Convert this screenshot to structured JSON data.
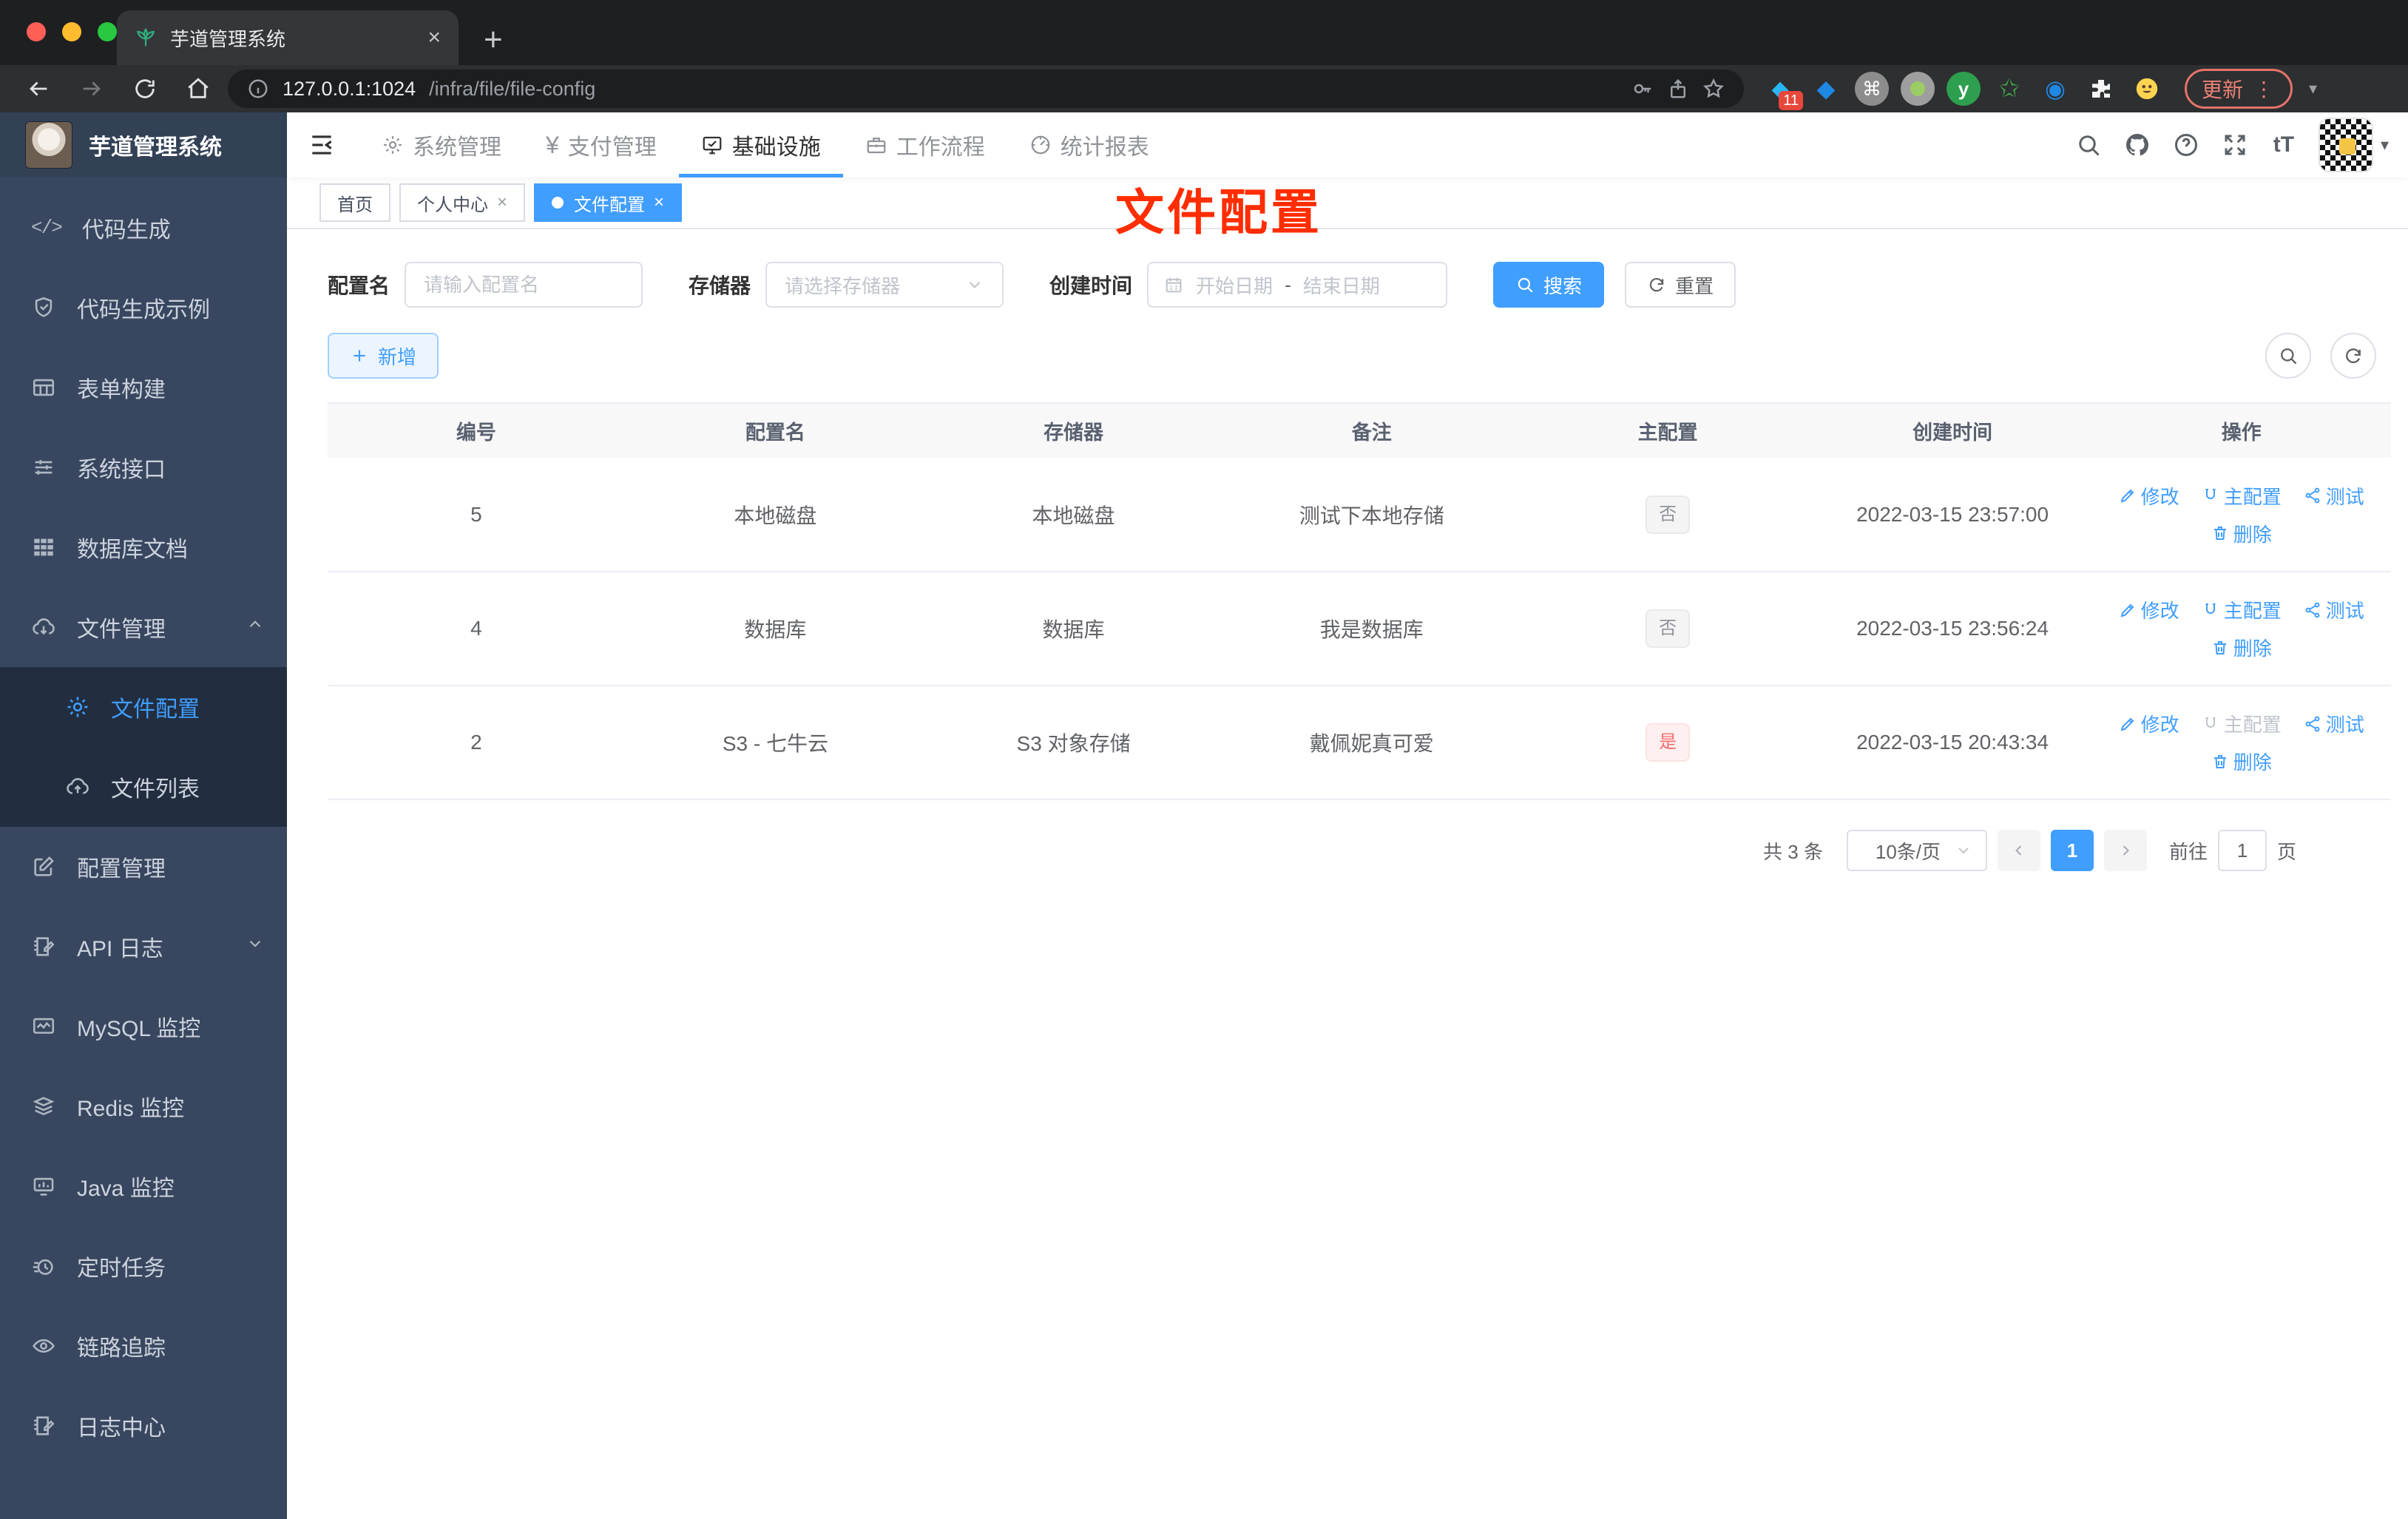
{
  "colors": {
    "accent": "#409eff",
    "annotation_red": "#ff2d00",
    "sidebar_bg": "#38475f",
    "submenu_bg": "#222e40"
  },
  "browser": {
    "tab_title": "芋道管理系统",
    "url_host": "127.0.0.1:1024",
    "url_path": "/infra/file/file-config",
    "update_label": "更新",
    "extension_badge": "11"
  },
  "glyphs": {
    "close": "×",
    "plus": "+",
    "yen": "¥",
    "font_size": "tT",
    "ellipsis": "⋮",
    "caret_down": "▾",
    "range_dash": "-",
    "cmd": "⌘",
    "star": "✩",
    "eye": "◉",
    "code": "</>"
  },
  "header": {
    "logo_title": "芋道管理系统",
    "nav": [
      {
        "label": "系统管理"
      },
      {
        "label": "支付管理"
      },
      {
        "label": "基础设施"
      },
      {
        "label": "工作流程"
      },
      {
        "label": "统计报表"
      }
    ]
  },
  "sidebar": {
    "items": [
      {
        "label": "代码生成"
      },
      {
        "label": "代码生成示例"
      },
      {
        "label": "表单构建"
      },
      {
        "label": "系统接口"
      },
      {
        "label": "数据库文档"
      },
      {
        "label": "文件管理",
        "children": [
          {
            "label": "文件配置"
          },
          {
            "label": "文件列表"
          }
        ]
      },
      {
        "label": "配置管理"
      },
      {
        "label": "API 日志"
      },
      {
        "label": "MySQL 监控"
      },
      {
        "label": "Redis 监控"
      },
      {
        "label": "Java 监控"
      },
      {
        "label": "定时任务"
      },
      {
        "label": "链路追踪"
      },
      {
        "label": "日志中心"
      }
    ]
  },
  "tags": [
    {
      "label": "首页"
    },
    {
      "label": "个人中心"
    },
    {
      "label": "文件配置"
    }
  ],
  "annotation": "文件配置",
  "filters": {
    "name_label": "配置名",
    "name_placeholder": "请输入配置名",
    "storage_label": "存储器",
    "storage_placeholder": "请选择存储器",
    "time_label": "创建时间",
    "start_placeholder": "开始日期",
    "range_sep": "-",
    "end_placeholder": "结束日期",
    "search_label": "搜索",
    "reset_label": "重置",
    "add_label": "新增"
  },
  "table": {
    "headers": [
      "编号",
      "配置名",
      "存储器",
      "备注",
      "主配置",
      "创建时间",
      "操作"
    ],
    "actions": {
      "edit": "修改",
      "master": "主配置",
      "test": "测试",
      "delete": "删除"
    },
    "rows": [
      {
        "id": "5",
        "name": "本地磁盘",
        "storage": "本地磁盘",
        "remark": "测试下本地存储",
        "master": "否",
        "created": "2022-03-15 23:57:00"
      },
      {
        "id": "4",
        "name": "数据库",
        "storage": "数据库",
        "remark": "我是数据库",
        "master": "否",
        "created": "2022-03-15 23:56:24"
      },
      {
        "id": "2",
        "name": "S3 - 七牛云",
        "storage": "S3 对象存储",
        "remark": "戴佩妮真可爱",
        "master": "是",
        "created": "2022-03-15 20:43:34"
      }
    ]
  },
  "pagination": {
    "total": "共 3 条",
    "page_size": "10条/页",
    "current": "1",
    "goto_label": "前往",
    "goto_value": "1",
    "unit": "页"
  }
}
